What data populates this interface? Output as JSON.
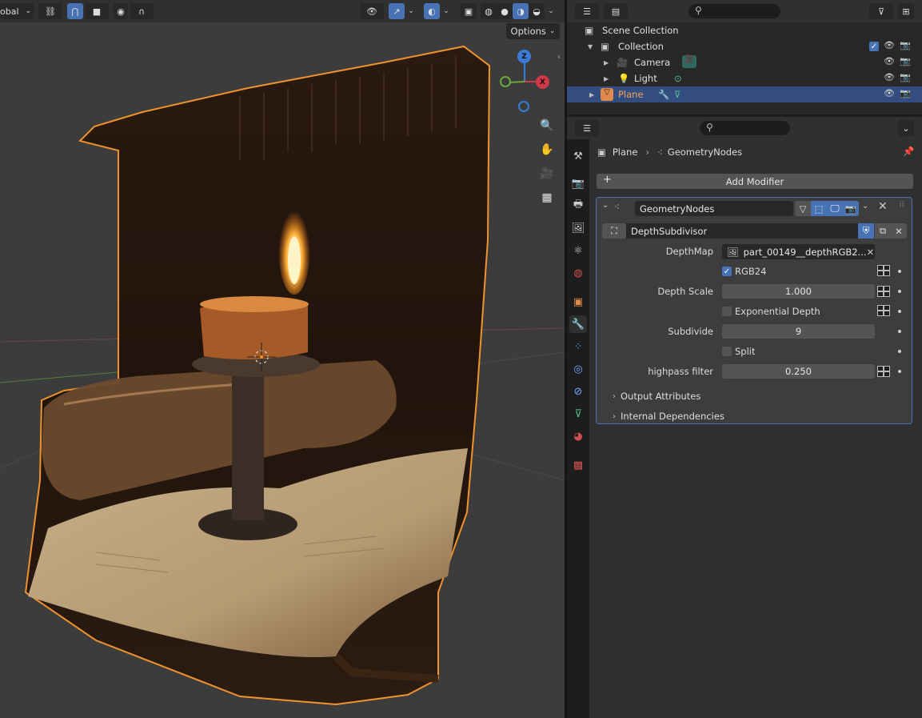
{
  "viewport": {
    "orientation_label": "obal",
    "options_label": "Options",
    "gizmo": {
      "z": "Z",
      "x": "X"
    }
  },
  "outliner": {
    "scene_collection": "Scene Collection",
    "collection": "Collection",
    "items": [
      "Camera",
      "Light",
      "Plane"
    ]
  },
  "properties": {
    "breadcrumb": {
      "object": "Plane",
      "modifier": "GeometryNodes"
    },
    "add_modifier": "Add Modifier",
    "modifier_name": "GeometryNodes",
    "node_group": "DepthSubdivisor",
    "inputs": {
      "depthmap_label": "DepthMap",
      "depthmap_value": "part_00149__depthRGB2...",
      "rgb24_label": "RGB24",
      "depth_scale_label": "Depth Scale",
      "depth_scale_value": "1.000",
      "exp_depth_label": "Exponential Depth",
      "subdivide_label": "Subdivide",
      "subdivide_value": "9",
      "split_label": "Split",
      "highpass_label": "highpass filter",
      "highpass_value": "0.250"
    },
    "panels": [
      "Output Attributes",
      "Internal Dependencies"
    ]
  },
  "colors": {
    "accent": "#4772b3",
    "selection_outline": "#f0932b",
    "selected_row": "#334d80"
  }
}
